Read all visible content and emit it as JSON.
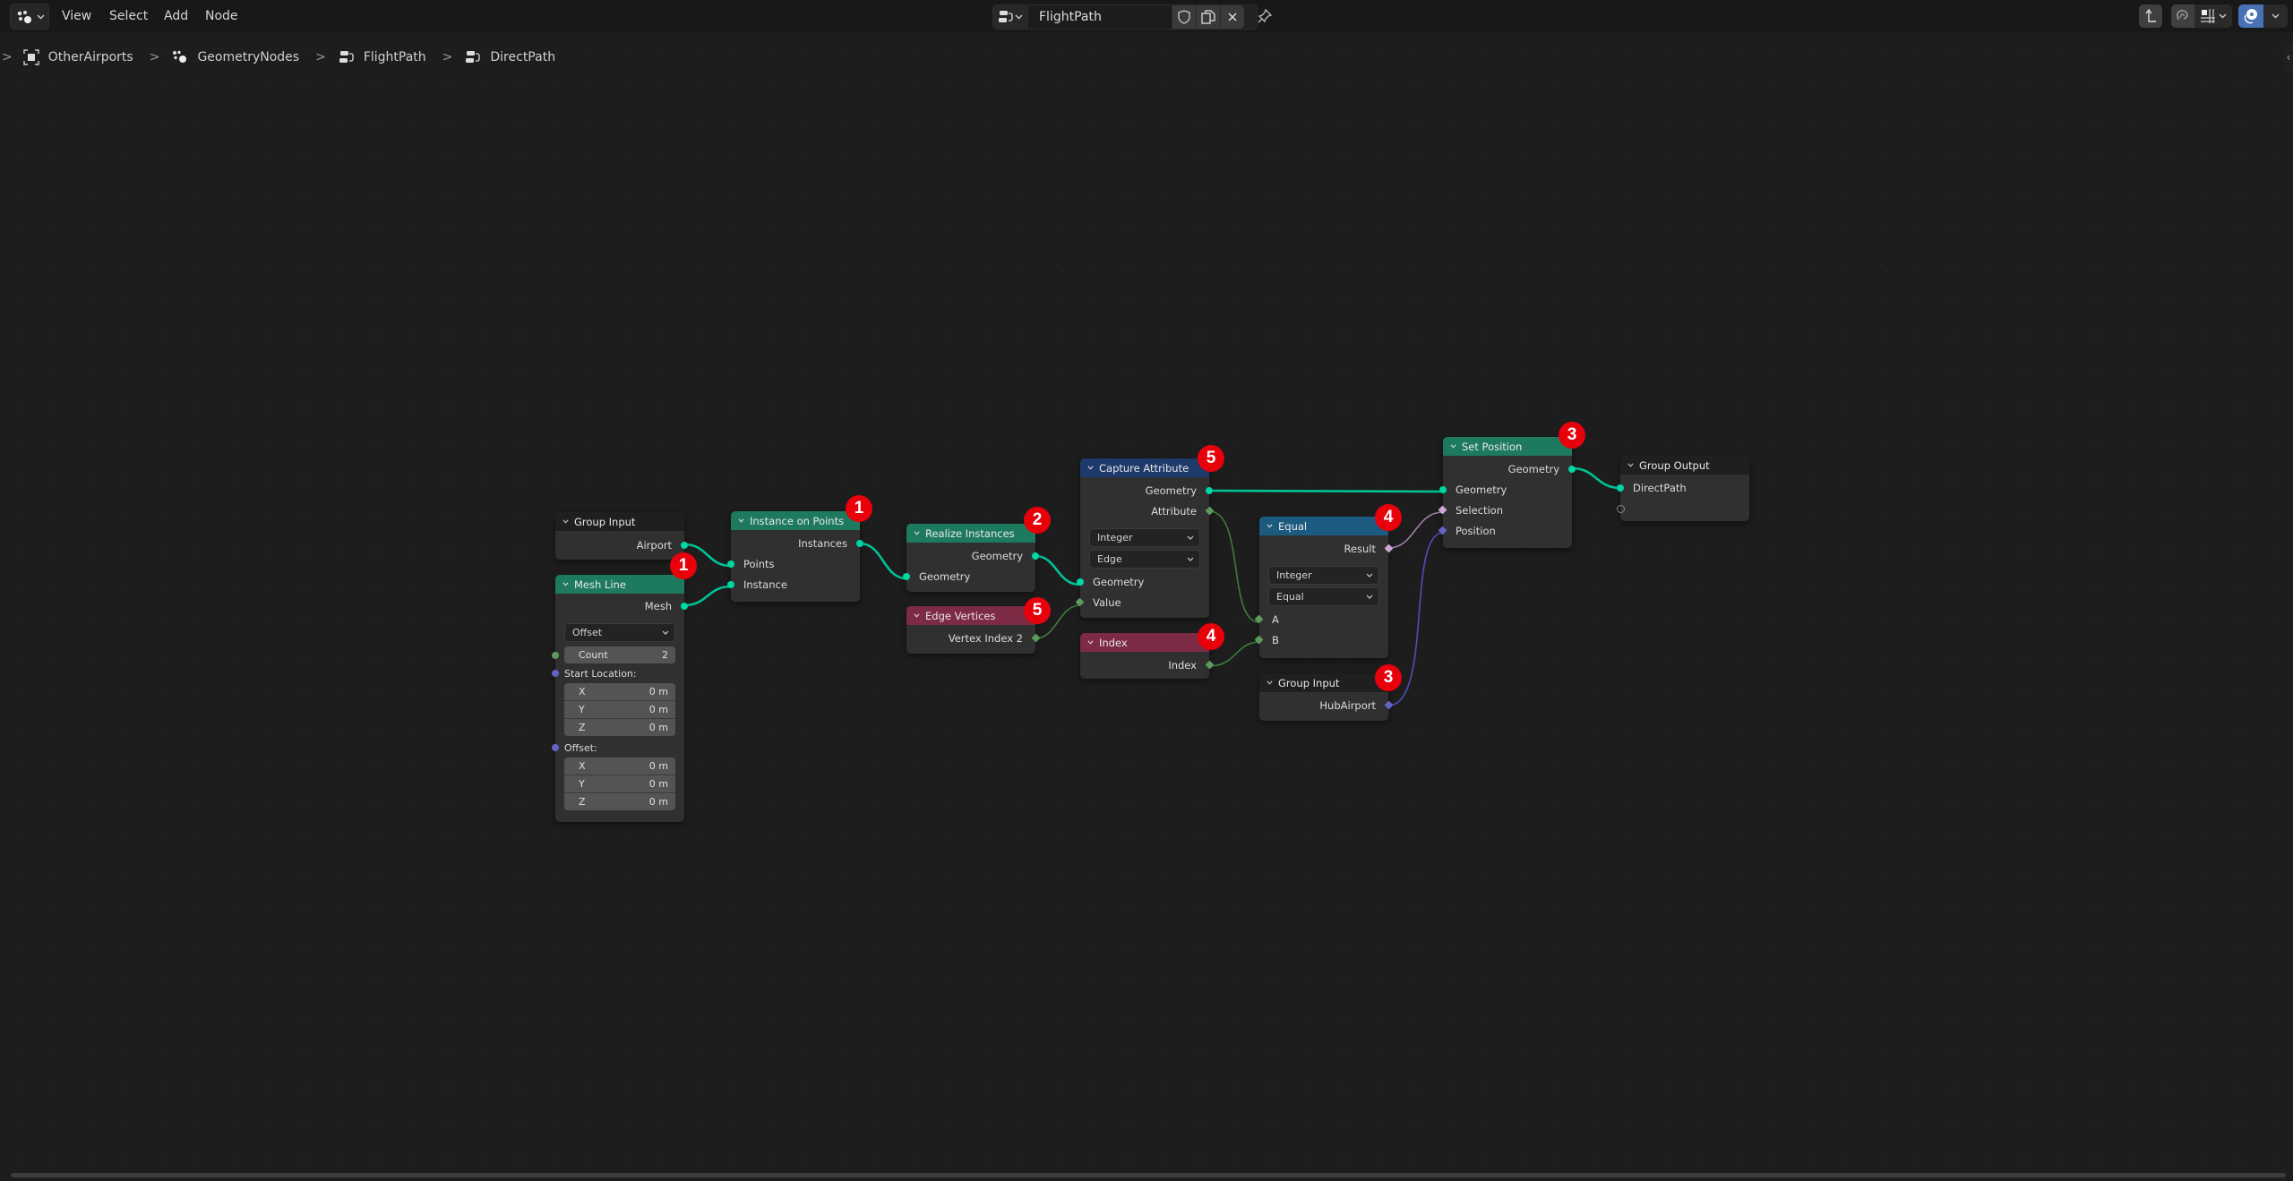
{
  "menubar": {
    "editor_type_icon": "node-editor-icon",
    "items": [
      "View",
      "Select",
      "Add",
      "Node"
    ]
  },
  "node_tree_selector": {
    "name": "FlightPath",
    "buttons": [
      "fake-user-shield-icon",
      "duplicate-icon",
      "unlink-x-icon"
    ],
    "pin_icon": "pin-icon"
  },
  "right_tools": {
    "parent_icon": "go-to-parent-icon",
    "snap_icon": "snap-magnet-icon",
    "snap_target_icon": "snap-grid-icon",
    "overlay_icon": "overlays-icon",
    "overlay_active": true
  },
  "breadcrumb": [
    {
      "icon": "object-icon",
      "label": "OtherAirports"
    },
    {
      "icon": "geometry-nodes-icon",
      "label": "GeometryNodes"
    },
    {
      "icon": "node-tree-icon",
      "label": "FlightPath"
    },
    {
      "icon": "node-tree-icon",
      "label": "DirectPath"
    }
  ],
  "colors": {
    "geometry_socket": "#00d6a3",
    "integer_socket": "#5b9a5b",
    "boolean_socket": "#cca6d6",
    "vector_socket": "#6363c7",
    "geometry_header": "#1e7a5f",
    "attribute_header": "#7d2a45",
    "converter_header": "#1e3a6a",
    "function_header": "#1d5a80",
    "badge": "#e8000b"
  },
  "nodes": {
    "group_input_1": {
      "title": "Group Input",
      "outputs": [
        "Airport"
      ]
    },
    "mesh_line": {
      "title": "Mesh Line",
      "outputs": [
        "Mesh"
      ],
      "mode": "Offset",
      "count_label": "Count",
      "count_value": "2",
      "start_label": "Start Location:",
      "start": [
        {
          "axis": "X",
          "value": "0 m"
        },
        {
          "axis": "Y",
          "value": "0 m"
        },
        {
          "axis": "Z",
          "value": "0 m"
        }
      ],
      "offset_label": "Offset:",
      "offset": [
        {
          "axis": "X",
          "value": "0 m"
        },
        {
          "axis": "Y",
          "value": "0 m"
        },
        {
          "axis": "Z",
          "value": "0 m"
        }
      ]
    },
    "instance_on_points": {
      "title": "Instance on Points",
      "outputs": [
        "Instances"
      ],
      "inputs": [
        "Points",
        "Instance"
      ]
    },
    "realize_instances": {
      "title": "Realize Instances",
      "outputs": [
        "Geometry"
      ],
      "inputs": [
        "Geometry"
      ]
    },
    "edge_vertices": {
      "title": "Edge Vertices",
      "outputs": [
        "Vertex Index 2"
      ]
    },
    "capture_attribute": {
      "title": "Capture Attribute",
      "outputs": [
        "Geometry",
        "Attribute"
      ],
      "data_type": "Integer",
      "domain": "Edge",
      "inputs": [
        "Geometry",
        "Value"
      ]
    },
    "index": {
      "title": "Index",
      "outputs": [
        "Index"
      ]
    },
    "equal": {
      "title": "Equal",
      "outputs": [
        "Result"
      ],
      "data_type": "Integer",
      "operation": "Equal",
      "inputs": [
        "A",
        "B"
      ]
    },
    "group_input_2": {
      "title": "Group Input",
      "outputs": [
        "HubAirport"
      ]
    },
    "set_position": {
      "title": "Set Position",
      "outputs": [
        "Geometry"
      ],
      "inputs": [
        "Geometry",
        "Selection",
        "Position"
      ]
    },
    "group_output": {
      "title": "Group Output",
      "inputs": [
        "DirectPath"
      ]
    }
  },
  "badges": {
    "instance_on_points": "1",
    "mesh_line": "1",
    "realize_instances": "2",
    "edge_vertices": "5",
    "capture_attribute": "5",
    "index": "4",
    "equal": "4",
    "group_input_2": "3",
    "set_position": "3"
  }
}
